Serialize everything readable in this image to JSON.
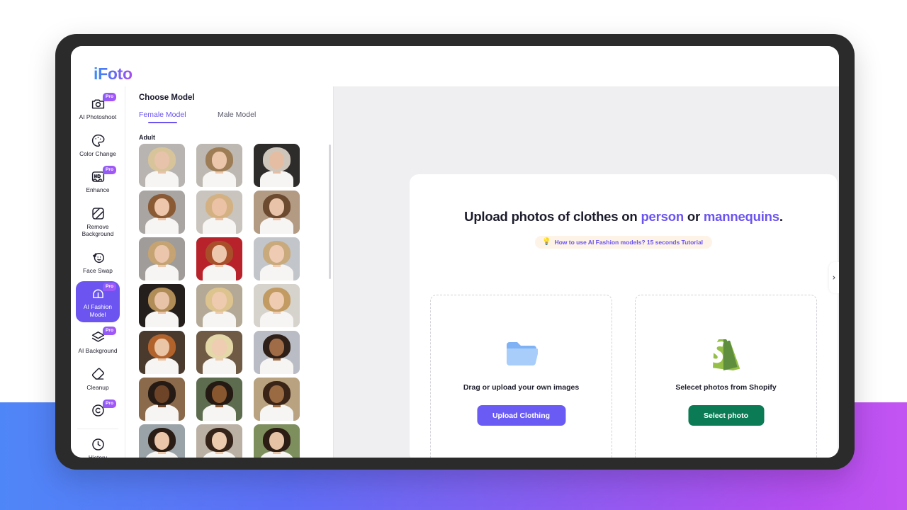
{
  "app": {
    "logo": "iFoto"
  },
  "sidebar": {
    "items": [
      {
        "label": "AI Photoshoot",
        "icon": "camera-icon",
        "pro": "Pro",
        "active": false
      },
      {
        "label": "Color Change",
        "icon": "palette-icon",
        "pro": "",
        "active": false
      },
      {
        "label": "Enhance",
        "icon": "hd-enhance-icon",
        "pro": "Pro",
        "active": false
      },
      {
        "label": "Remove Background",
        "icon": "remove-bg-icon",
        "pro": "",
        "active": false
      },
      {
        "label": "Face Swap",
        "icon": "face-swap-icon",
        "pro": "",
        "active": false
      },
      {
        "label": "AI Fashion Model",
        "icon": "fashion-model-icon",
        "pro": "Pro",
        "active": true
      },
      {
        "label": "AI Background",
        "icon": "layers-icon",
        "pro": "Pro",
        "active": false
      },
      {
        "label": "Cleanup",
        "icon": "eraser-icon",
        "pro": "",
        "active": false
      },
      {
        "label": "",
        "icon": "copyright-icon",
        "pro": "Pro",
        "active": false
      },
      {
        "label": "History",
        "icon": "clock-icon",
        "pro": "",
        "active": false
      }
    ]
  },
  "model_panel": {
    "title": "Choose Model",
    "tabs": [
      {
        "label": "Female Model",
        "active": true
      },
      {
        "label": "Male Model",
        "active": false
      }
    ],
    "group_label": "Adult",
    "thumbnails": [
      {
        "id": "model-1",
        "bg": "#b7b4b2",
        "hair": "#d8c49a",
        "skin": "#e8c3ab"
      },
      {
        "id": "model-2",
        "bg": "#bdb8b1",
        "hair": "#9d7d56",
        "skin": "#ecc6ab"
      },
      {
        "id": "model-3",
        "bg": "#2e2b2b",
        "hair": "#cfc6bb",
        "skin": "#e5bda3"
      },
      {
        "id": "model-4",
        "bg": "#a8a5a3",
        "hair": "#8a5a34",
        "skin": "#edc6ab"
      },
      {
        "id": "model-5",
        "bg": "#c9c4bd",
        "hair": "#d4b183",
        "skin": "#ecc2a6"
      },
      {
        "id": "model-6",
        "bg": "#b39a82",
        "hair": "#6b4a30",
        "skin": "#e9c3a9"
      },
      {
        "id": "model-7",
        "bg": "#9f9c99",
        "hair": "#c6a372",
        "skin": "#ecc6ac"
      },
      {
        "id": "model-8",
        "bg": "#b8232b",
        "hair": "#a84f2a",
        "skin": "#edc7ad"
      },
      {
        "id": "model-9",
        "bg": "#c2c5ca",
        "hair": "#c9aa7d",
        "skin": "#eecbb2"
      },
      {
        "id": "model-10",
        "bg": "#241f1c",
        "hair": "#b08c56",
        "skin": "#e9c3a7"
      },
      {
        "id": "model-11",
        "bg": "#b4a996",
        "hair": "#ddc48e",
        "skin": "#eecbae"
      },
      {
        "id": "model-12",
        "bg": "#d6d2cc",
        "hair": "#c29b63",
        "skin": "#eecbb1"
      },
      {
        "id": "model-13",
        "bg": "#4a3a2e",
        "hair": "#b2632c",
        "skin": "#eac5a6"
      },
      {
        "id": "model-14",
        "bg": "#6e5a45",
        "hair": "#e4d7a8",
        "skin": "#eecdb2"
      },
      {
        "id": "model-15",
        "bg": "#b9bcc4",
        "hair": "#2e2018",
        "skin": "#a06c48"
      },
      {
        "id": "model-16",
        "bg": "#8a6a4a",
        "hair": "#251a14",
        "skin": "#6e4429"
      },
      {
        "id": "model-17",
        "bg": "#5d6b4e",
        "hair": "#241913",
        "skin": "#89572f"
      },
      {
        "id": "model-18",
        "bg": "#b8a27f",
        "hair": "#3a2418",
        "skin": "#9a6a42"
      },
      {
        "id": "model-19",
        "bg": "#9aa3a8",
        "hair": "#2a1d16",
        "skin": "#ecc6a8"
      },
      {
        "id": "model-20",
        "bg": "#bab0a3",
        "hair": "#35231a",
        "skin": "#eccaae"
      },
      {
        "id": "model-21",
        "bg": "#7e8f5e",
        "hair": "#2b1c14",
        "skin": "#e7c3a5"
      }
    ]
  },
  "main": {
    "headline_prefix": "Upload photos of clothes on ",
    "headline_hl1": "person",
    "headline_middle": " or ",
    "headline_hl2": "mannequins",
    "headline_suffix": ".",
    "tutorial_text": "How to use AI Fashion models? 15 seconds Tutorial",
    "tutorial_icon": "lightbulb-icon",
    "cards": [
      {
        "icon": "folder-icon",
        "caption": "Drag or upload your own images",
        "button": "Upload Clothing",
        "button_color": "#6b5bf5"
      },
      {
        "icon": "shopify-bag-icon",
        "caption": "Selecet photos from Shopify",
        "button": "Select photo",
        "button_color": "#0b7b55"
      }
    ]
  },
  "collapse": {
    "icon": "chevron-right-icon"
  },
  "colors": {
    "accent_purple": "#6b54ef",
    "shopify_green": "#0b7b55",
    "bg_gradient_start": "#4f86f7",
    "bg_gradient_end": "#c254f2",
    "panel_gray": "#efeff1"
  }
}
